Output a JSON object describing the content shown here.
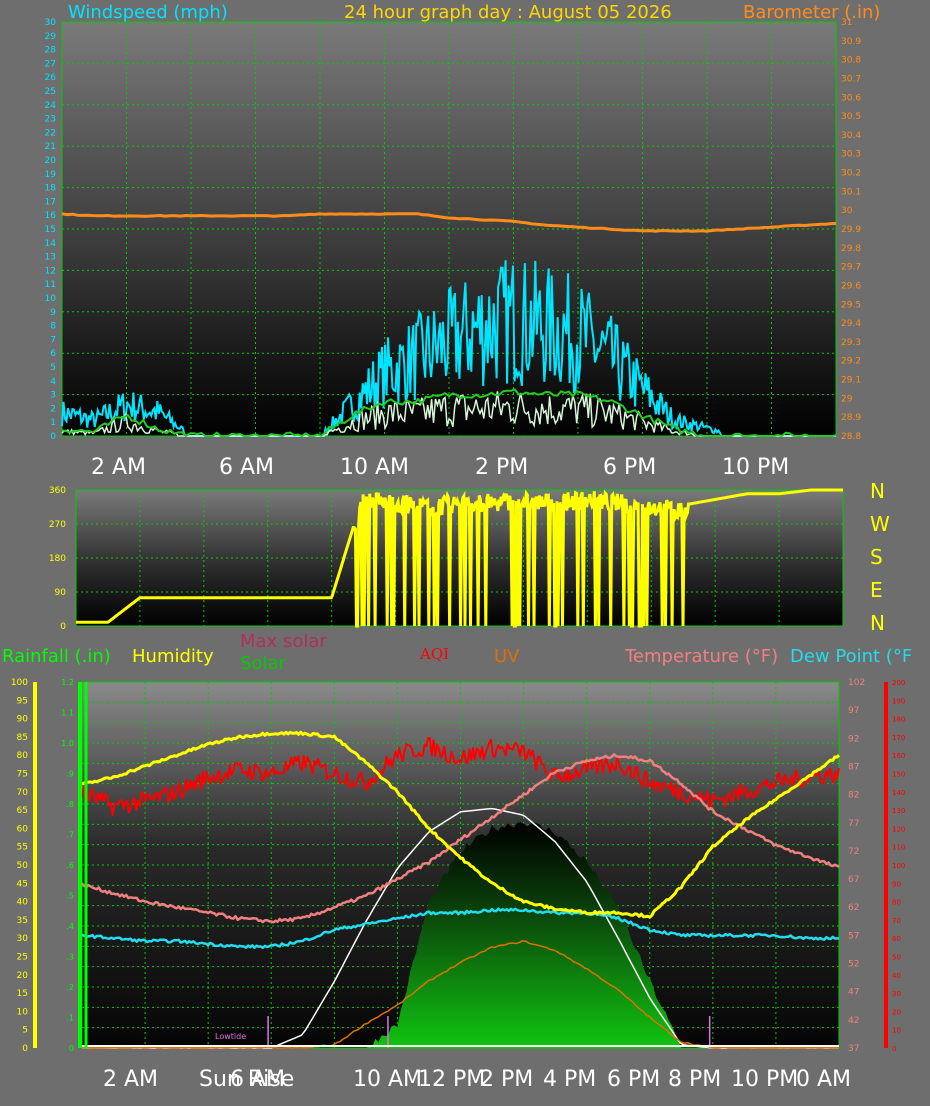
{
  "header": {
    "wind_label": "Windspeed (mph)",
    "title": "24 hour graph day : August 05 2026",
    "baro_label": "Barometer (.in)"
  },
  "colors": {
    "wind": "#00e5ff",
    "gust_avg": "#22cc22",
    "wind_low": "#d8f5d8",
    "baro": "#ff8c1a",
    "direction": "#ffff00",
    "humidity": "#ffff00",
    "temperature": "#f08080",
    "dew_point": "#22ddee",
    "aqi": "#ff0000",
    "uv": "#e07000",
    "solar": "#00c000",
    "max_solar": "#ffffff",
    "rain": "#00ff00",
    "grid": "#00cc00"
  },
  "x_labels_top": [
    "2 AM",
    "6 AM",
    "10 AM",
    "2 PM",
    "6 PM",
    "10 PM"
  ],
  "compass": [
    "N",
    "W",
    "S",
    "E",
    "N"
  ],
  "bottom_labels": {
    "rainfall": "Rainfall (.in)",
    "humidity": "Humidity",
    "max_solar": "Max solar",
    "solar": "Solar",
    "aqi": "AQI",
    "uv": "UV",
    "temperature": "Temperature (°F)",
    "dew_point": "Dew Point (°F"
  },
  "x_labels_bottom": [
    "2 AM",
    "6 AM",
    "10 AM",
    "12 PM",
    "2 PM",
    "4 PM",
    "6 PM",
    "8 PM",
    "10 PM",
    "0 AM"
  ],
  "sun_rise_label": "Sun Rise",
  "lowtide_label": "Lowtide",
  "chart_data": [
    {
      "type": "line",
      "name": "wind-baro",
      "title": "24 hour graph day : August 05 2026",
      "ylabel": "Windspeed (mph)",
      "y2label": "Barometer (.in)",
      "ylim": [
        0,
        30
      ],
      "y2lim": [
        28.8,
        31
      ],
      "x_hours": [
        0,
        1,
        2,
        3,
        4,
        5,
        6,
        7,
        8,
        9,
        10,
        11,
        12,
        13,
        14,
        15,
        16,
        17,
        18,
        19,
        20,
        21,
        22,
        23,
        24
      ],
      "series": [
        {
          "name": "Windspeed (mph)",
          "values": [
            1.5,
            1,
            2,
            1.5,
            0,
            0,
            0,
            0,
            0,
            2,
            4,
            5,
            6,
            7,
            7.5,
            7,
            6.5,
            5,
            3,
            1,
            0.5,
            0,
            0,
            0,
            0
          ]
        },
        {
          "name": "Barometer (.in)",
          "values": [
            29.98,
            29.97,
            29.97,
            29.97,
            29.97,
            29.97,
            29.97,
            29.97,
            29.98,
            29.98,
            29.98,
            29.98,
            29.96,
            29.95,
            29.94,
            29.92,
            29.91,
            29.9,
            29.89,
            29.89,
            29.89,
            29.9,
            29.91,
            29.92,
            29.93
          ]
        }
      ],
      "gust_avg": [
        0.5,
        0.3,
        1.5,
        0.5,
        0,
        0,
        0,
        0,
        0,
        1.5,
        2.5,
        2.5,
        3,
        3,
        3.2,
        3,
        3,
        2.5,
        1.5,
        0.5,
        0,
        0,
        0,
        0,
        0
      ],
      "grid": true
    },
    {
      "type": "line",
      "name": "wind-direction",
      "ylim": [
        0,
        360
      ],
      "yticks": [
        0,
        90,
        180,
        270,
        360
      ],
      "x_hours": [
        0,
        1,
        2,
        3,
        4,
        5,
        6,
        7,
        8,
        9,
        10,
        11,
        12,
        13,
        14,
        15,
        16,
        17,
        18,
        19,
        20,
        21,
        22,
        23,
        24
      ],
      "values": [
        10,
        10,
        75,
        75,
        75,
        75,
        75,
        75,
        75,
        350,
        340,
        330,
        340,
        340,
        345,
        340,
        350,
        340,
        330,
        320,
        335,
        350,
        350,
        360,
        360
      ],
      "grid": true
    },
    {
      "type": "line",
      "name": "temp-humidity-solar",
      "ylim_humidity": [
        0,
        100
      ],
      "ylim_temperature": [
        37,
        102
      ],
      "ylim_rain": [
        0,
        1.2
      ],
      "ylim_aqi": [
        0,
        200
      ],
      "x_hours": [
        0,
        1,
        2,
        3,
        4,
        5,
        6,
        7,
        8,
        9,
        10,
        11,
        12,
        13,
        14,
        15,
        16,
        17,
        18,
        19,
        20,
        21,
        22,
        23,
        24
      ],
      "series": [
        {
          "name": "Humidity",
          "values": [
            72,
            74,
            77,
            80,
            83,
            85,
            86,
            86,
            85,
            78,
            70,
            60,
            52,
            45,
            40,
            38,
            37,
            37,
            36,
            44,
            55,
            62,
            68,
            74,
            80
          ]
        },
        {
          "name": "Temperature (°F)",
          "values": [
            66,
            64.5,
            63,
            62,
            61,
            60,
            59.5,
            60,
            62,
            64,
            67,
            70,
            74,
            78,
            82,
            86,
            88,
            89,
            88,
            84,
            79,
            76,
            73,
            71,
            69
          ]
        },
        {
          "name": "Dew Point (°F",
          "values": [
            57,
            56.5,
            56,
            56,
            55.5,
            55,
            55,
            56,
            58,
            59,
            60,
            61,
            61,
            61.5,
            61.5,
            61,
            61,
            60,
            58,
            57,
            57,
            57,
            57,
            56.5,
            56.5
          ]
        },
        {
          "name": "AQI",
          "values": [
            140,
            132,
            135,
            140,
            148,
            152,
            150,
            156,
            150,
            145,
            160,
            165,
            158,
            164,
            162,
            148,
            152,
            156,
            145,
            140,
            135,
            140,
            145,
            148,
            150
          ]
        },
        {
          "name": "Solar",
          "values": [
            0,
            0,
            0,
            0,
            0,
            0,
            0,
            0,
            0,
            0,
            70,
            440,
            590,
            660,
            680,
            650,
            560,
            420,
            200,
            0,
            0,
            0,
            0,
            0,
            0
          ]
        },
        {
          "name": "Max solar",
          "values": [
            0,
            0,
            0,
            0,
            0,
            0,
            0,
            40,
            200,
            380,
            540,
            650,
            710,
            720,
            700,
            620,
            500,
            330,
            150,
            10,
            0,
            0,
            0,
            0,
            0
          ]
        },
        {
          "name": "UV",
          "values": [
            0,
            0,
            0,
            0,
            0,
            0,
            0,
            0,
            0.1,
            0.8,
            1.4,
            2.2,
            2.8,
            3.3,
            3.5,
            3.2,
            2.6,
            1.9,
            1,
            0.2,
            0,
            0,
            0,
            0,
            0
          ]
        }
      ],
      "grid": true
    }
  ]
}
